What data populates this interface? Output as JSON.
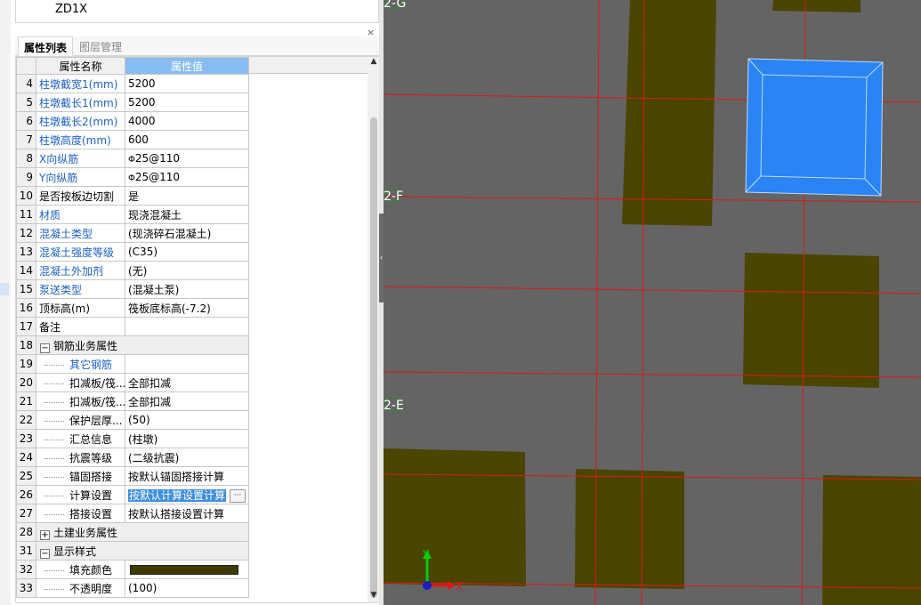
{
  "tree": {
    "item": "ZD1X"
  },
  "panel": {
    "close_glyph": "×"
  },
  "tabs": [
    {
      "label": "属性列表",
      "active": true
    },
    {
      "label": "图层管理",
      "active": false
    }
  ],
  "grid": {
    "header": {
      "name": "属性名称",
      "value": "属性值"
    },
    "rows": [
      {
        "num": "4",
        "name": "柱墩截宽1(mm)",
        "value": "5200",
        "blue": true
      },
      {
        "num": "5",
        "name": "柱墩截长1(mm)",
        "value": "5200",
        "blue": true
      },
      {
        "num": "6",
        "name": "柱墩截长2(mm)",
        "value": "4000",
        "blue": true
      },
      {
        "num": "7",
        "name": "柱墩高度(mm)",
        "value": "600",
        "blue": true
      },
      {
        "num": "8",
        "name": "X向纵筋",
        "value": "25@110",
        "blue": true,
        "rebar": true
      },
      {
        "num": "9",
        "name": "Y向纵筋",
        "value": "25@110",
        "blue": true,
        "rebar": true
      },
      {
        "num": "10",
        "name": "是否按板边切割",
        "value": "是",
        "blue": false
      },
      {
        "num": "11",
        "name": "材质",
        "value": "现浇混凝土",
        "blue": true
      },
      {
        "num": "12",
        "name": "混凝土类型",
        "value": "(现浇碎石混凝土)",
        "blue": true
      },
      {
        "num": "13",
        "name": "混凝土强度等级",
        "value": "(C35)",
        "blue": true
      },
      {
        "num": "14",
        "name": "混凝土外加剂",
        "value": "(无)",
        "blue": true
      },
      {
        "num": "15",
        "name": "泵送类型",
        "value": "(混凝土泵)",
        "blue": true
      },
      {
        "num": "16",
        "name": "顶标高(m)",
        "value": "筏板底标高(-7.2)",
        "blue": false
      },
      {
        "num": "17",
        "name": "备注",
        "value": "",
        "blue": false
      },
      {
        "num": "18",
        "name": "钢筋业务属性",
        "value": "",
        "group": true,
        "toggle": "−"
      },
      {
        "num": "19",
        "name": "其它钢筋",
        "value": "",
        "child": true,
        "blue": true
      },
      {
        "num": "20",
        "name": "扣减板/筏...",
        "value": "全部扣减",
        "child": true
      },
      {
        "num": "21",
        "name": "扣减板/筏...",
        "value": "全部扣减",
        "child": true
      },
      {
        "num": "22",
        "name": "保护层厚...",
        "value": "(50)",
        "child": true
      },
      {
        "num": "23",
        "name": "汇总信息",
        "value": "(柱墩)",
        "child": true
      },
      {
        "num": "24",
        "name": "抗震等级",
        "value": "(二级抗震)",
        "child": true
      },
      {
        "num": "25",
        "name": "锚固搭接",
        "value": "按默认锚固搭接计算",
        "child": true
      },
      {
        "num": "26",
        "name": "计算设置",
        "value": "按默认计算设置计算",
        "child": true,
        "selected": true
      },
      {
        "num": "27",
        "name": "搭接设置",
        "value": "按默认搭接设置计算",
        "child": true
      },
      {
        "num": "28",
        "name": "土建业务属性",
        "value": "",
        "group": true,
        "toggle": "+"
      },
      {
        "num": "31",
        "name": "显示样式",
        "value": "",
        "group": true,
        "toggle": "−"
      },
      {
        "num": "32",
        "name": "填充颜色",
        "value": "",
        "child": true,
        "swatch": true
      },
      {
        "num": "33",
        "name": "不透明度",
        "value": "(100)",
        "child": true
      }
    ],
    "rebar_symbol": "Φ",
    "ellipsis": "···"
  },
  "viewport": {
    "axis_labels": [
      "2-G",
      "2-F",
      "2-E"
    ],
    "axis_x": "X",
    "axis_y": "Y",
    "colors": {
      "background": "#646464",
      "column": "#4a4500",
      "grid_line": "#e01818",
      "selected": "#2a84f4"
    }
  }
}
